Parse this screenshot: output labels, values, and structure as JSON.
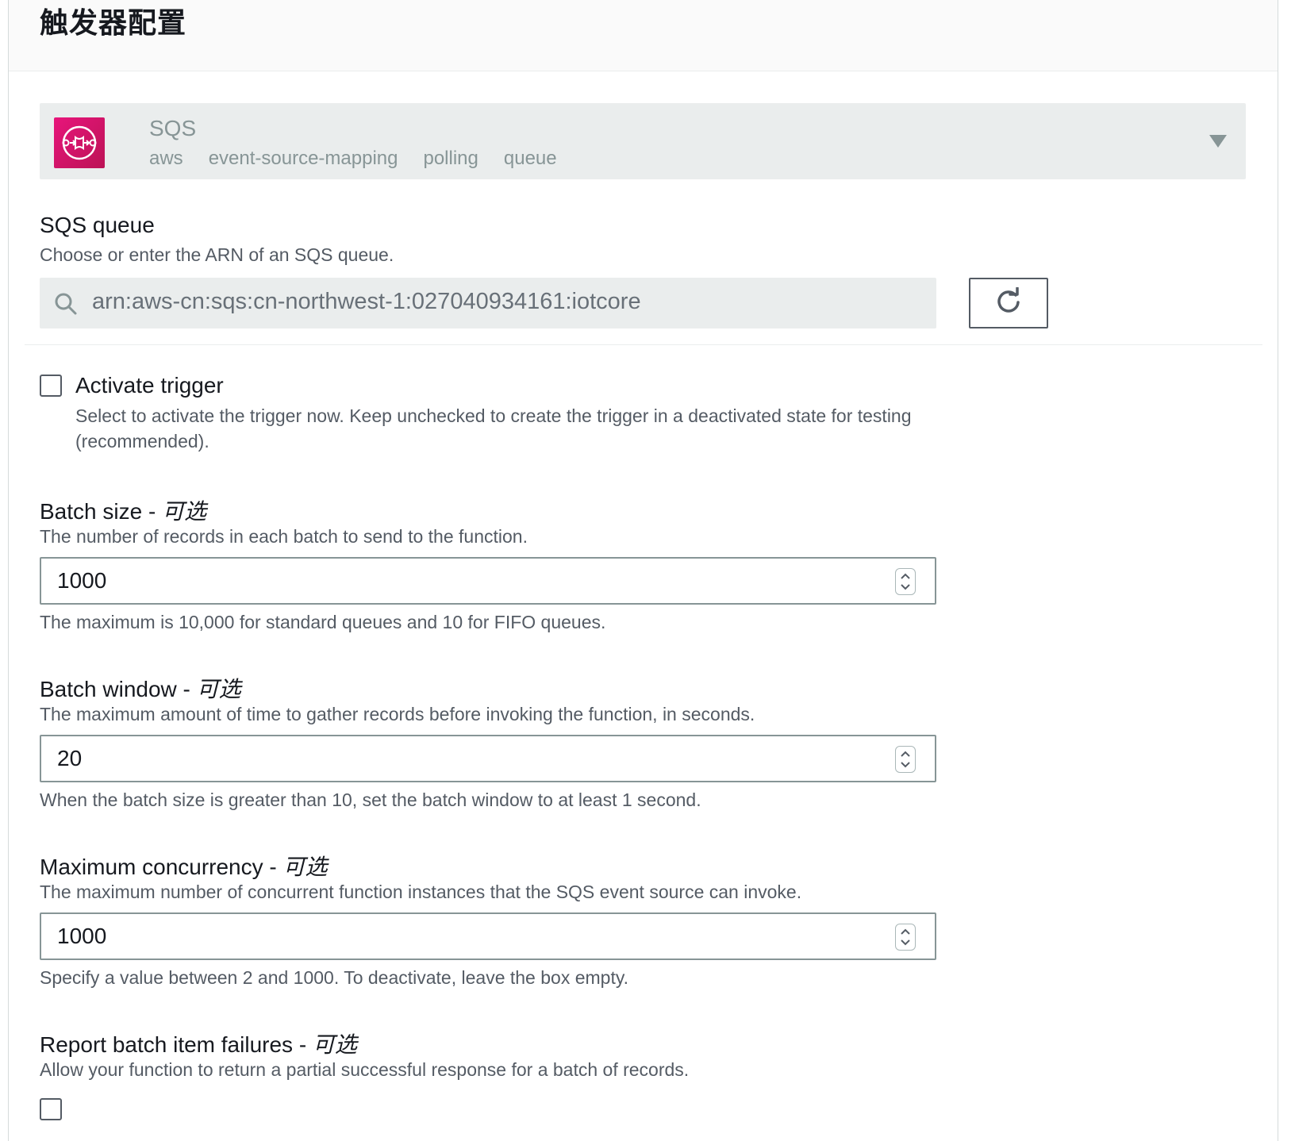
{
  "panel": {
    "title": "触发器配置"
  },
  "source": {
    "name": "SQS",
    "tags": [
      "aws",
      "event-source-mapping",
      "polling",
      "queue"
    ],
    "icon": "sqs-service-icon"
  },
  "sqs_queue": {
    "label": "SQS queue",
    "description": "Choose or enter the ARN of an SQS queue.",
    "value": "arn:aws-cn:sqs:cn-northwest-1:027040934161:iotcore"
  },
  "activate": {
    "label": "Activate trigger",
    "description": "Select to activate the trigger now. Keep unchecked to create the trigger in a deactivated state for testing (recommended).",
    "checked": false
  },
  "batch_size": {
    "label": "Batch size - ",
    "optional": "可选",
    "description": "The number of records in each batch to send to the function.",
    "value": "1000",
    "hint": "The maximum is 10,000 for standard queues and 10 for FIFO queues."
  },
  "batch_window": {
    "label": "Batch window - ",
    "optional": "可选",
    "description": "The maximum amount of time to gather records before invoking the function, in seconds.",
    "value": "20",
    "hint": "When the batch size is greater than 10, set the batch window to at least 1 second."
  },
  "max_concurrency": {
    "label": "Maximum concurrency - ",
    "optional": "可选",
    "description": "The maximum number of concurrent function instances that the SQS event source can invoke.",
    "value": "1000",
    "hint": "Specify a value between 2 and 1000. To deactivate, leave the box empty."
  },
  "report_failures": {
    "label": "Report batch item failures - ",
    "optional": "可选",
    "description": "Allow your function to return a partial successful response for a batch of records.",
    "checked": false
  },
  "colors": {
    "header_bg": "#fafafa",
    "disabled_bg": "#eaeded",
    "sqs_brand": "#e7157b",
    "muted_text": "#545b64"
  }
}
